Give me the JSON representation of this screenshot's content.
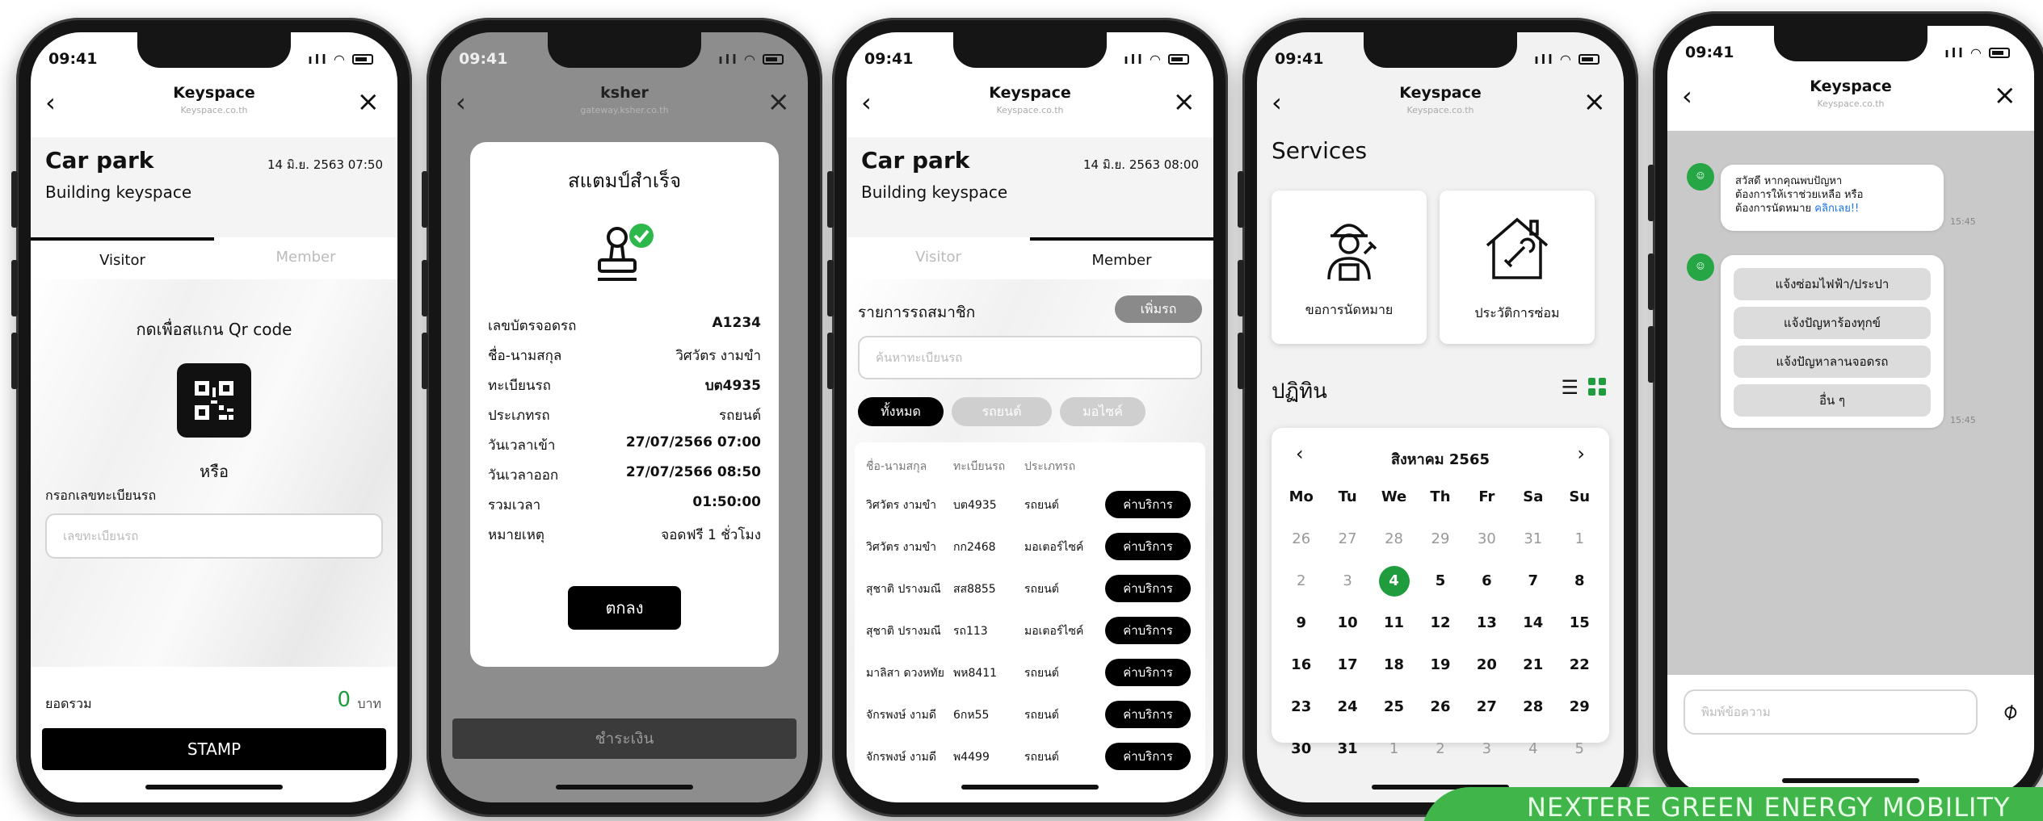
{
  "status": {
    "time": "09:41"
  },
  "banner": {
    "text": "NEXTERE GREEN ENERGY MOBILITY"
  },
  "screen1": {
    "nav_title": "Keyspace",
    "nav_subtitle": "Keyspace.co.th",
    "title": "Car park",
    "date": "14 มิ.ย. 2563  07:50",
    "building": "Building keyspace",
    "tab_visitor": "Visitor",
    "tab_member": "Member",
    "scan_label": "กดเพื่อสแกน Qr code",
    "or_label": "หรือ",
    "plate_label": "กรอกเลขทะเบียนรถ",
    "plate_placeholder": "เลขทะเบียนรถ",
    "total_label": "ยอดรวม",
    "total_value": "0",
    "total_unit": "บาท",
    "stamp_button": "STAMP"
  },
  "screen2": {
    "nav_title": "ksher",
    "nav_subtitle": "gateway.ksher.co.th",
    "modal_title": "สแตมป์สำเร็จ",
    "rows": [
      {
        "k": "เลขบัตรจอดรถ",
        "v": "A1234"
      },
      {
        "k": "ชื่อ-นามสกุล",
        "v": "วิศวัตร งามขำ"
      },
      {
        "k": "ทะเบียนรถ",
        "v": "บต4935"
      },
      {
        "k": "ประเภทรถ",
        "v": "รถยนต์"
      },
      {
        "k": "วันเวลาเข้า",
        "v": "27/07/2566 07:00"
      },
      {
        "k": "วันเวลาออก",
        "v": "27/07/2566 08:50"
      },
      {
        "k": "รวมเวลา",
        "v": "01:50:00"
      },
      {
        "k": "หมายเหตุ",
        "v": "จอดฟรี 1 ชั่วโมง"
      }
    ],
    "ok_button": "ตกลง",
    "pay_button": "ชำระเงิน"
  },
  "screen3": {
    "nav_title": "Keyspace",
    "nav_subtitle": "Keyspace.co.th",
    "title": "Car park",
    "date": "14 มิ.ย. 2563  08:00",
    "building": "Building keyspace",
    "tab_visitor": "Visitor",
    "tab_member": "Member",
    "list_title": "รายการรถสมาชิก",
    "add_button": "เพิ่มรถ",
    "search_placeholder": "ค้นหาทะเบียนรถ",
    "filters": [
      "ทั้งหมด",
      "รถยนต์",
      "มอไซค์"
    ],
    "columns": [
      "ชื่อ-นามสกุล",
      "ทะเบียนรถ",
      "ประเภทรถ"
    ],
    "service_label": "ค่าบริการ",
    "rows": [
      {
        "name": "วิศวัตร งามขำ",
        "plate": "บต4935",
        "type": "รถยนต์"
      },
      {
        "name": "วิศวัตร งามขำ",
        "plate": "กก2468",
        "type": "มอเตอร์ไซค์"
      },
      {
        "name": "สุชาติ ปรางมณี",
        "plate": "สส8855",
        "type": "รถยนต์"
      },
      {
        "name": "สุชาติ ปรางมณี",
        "plate": "รถ113",
        "type": "มอเตอร์ไซค์"
      },
      {
        "name": "มาลิสา ดวงหทัย",
        "plate": "พห8411",
        "type": "รถยนต์"
      },
      {
        "name": "จักรพงษ์ งามดี",
        "plate": "6กห55",
        "type": "รถยนต์"
      },
      {
        "name": "จักรพงษ์ งามดี",
        "plate": "พ4499",
        "type": "รถยนต์"
      }
    ]
  },
  "screen4": {
    "nav_title": "Keyspace",
    "nav_subtitle": "Keyspace.co.th",
    "services_title": "Services",
    "card_appointment": "ขอการนัดหมาย",
    "card_history": "ประวัติการซ่อม",
    "calendar_title": "ปฏิทิน",
    "month": "สิงหาคม 2565",
    "weekdays": [
      "Mo",
      "Tu",
      "We",
      "Th",
      "Fr",
      "Sa",
      "Su"
    ],
    "weeks": [
      [
        "26",
        "27",
        "28",
        "29",
        "30",
        "31",
        "1"
      ],
      [
        "2",
        "3",
        "4",
        "5",
        "6",
        "7",
        "8"
      ],
      [
        "9",
        "10",
        "11",
        "12",
        "13",
        "14",
        "15"
      ],
      [
        "16",
        "17",
        "18",
        "19",
        "20",
        "21",
        "22"
      ],
      [
        "23",
        "24",
        "25",
        "26",
        "27",
        "28",
        "29"
      ],
      [
        "30",
        "31",
        "1",
        "2",
        "3",
        "4",
        "5"
      ]
    ],
    "selected_day": "4"
  },
  "screen5": {
    "nav_title": "Keyspace",
    "nav_subtitle": "Keyspace.co.th",
    "msg1_line1": "สวัสดี หากคุณพบปัญหา",
    "msg1_line2": "ต้องการให้เราช่วยเหลือ หรือ",
    "msg1_line3": "ต้องการนัดหมาย",
    "msg1_link": "คลิกเลย!!",
    "time1": "15:45",
    "quick_replies": [
      "แจ้งซ่อมไฟฟ้า/ประปา",
      "แจ้งปัญหาร้องทุกข์",
      "แจ้งปัญหาลานจอดรถ",
      "อื่น ๆ"
    ],
    "time2": "15:45",
    "input_placeholder": "พิมพ์ข้อความ"
  }
}
